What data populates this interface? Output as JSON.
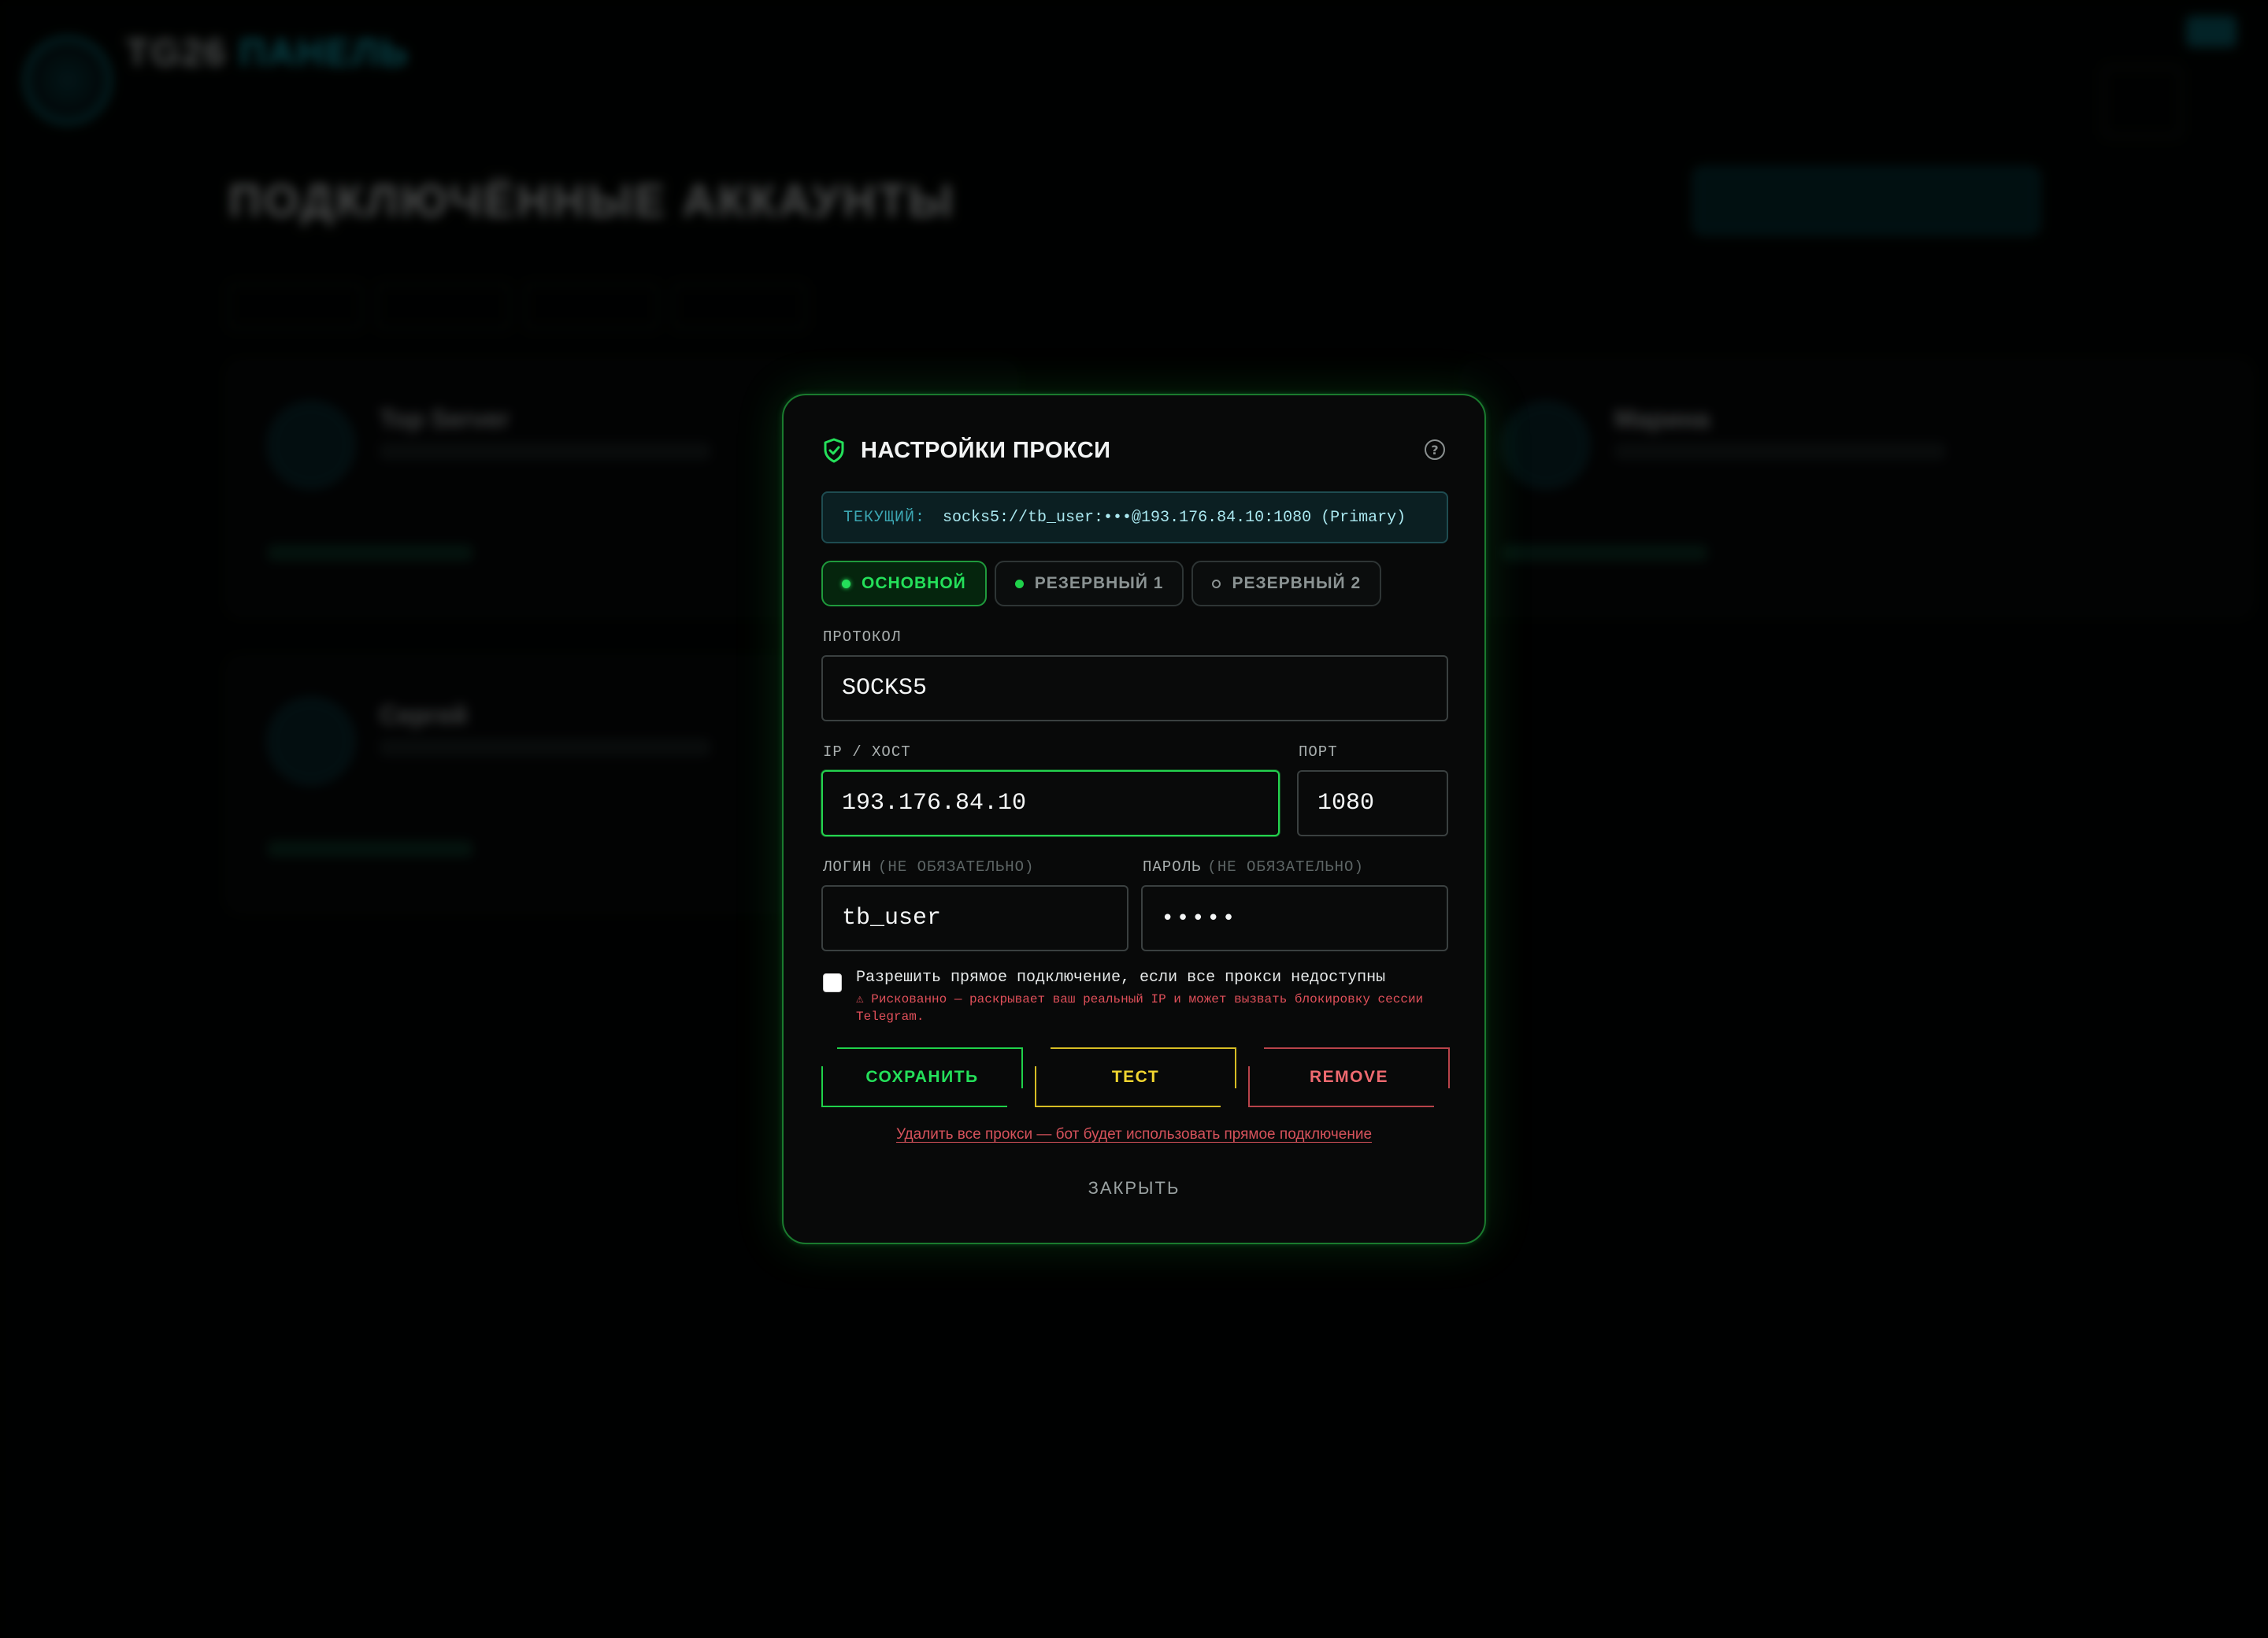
{
  "background": {
    "brand": {
      "title_main": "TG26",
      "title_accent": "ПАНЕЛЬ"
    },
    "page": {
      "title": "ПОДКЛЮЧЁННЫЕ АККАУНТЫ"
    },
    "cards": [
      {
        "name": "Top Server"
      },
      {
        "name": "Марина"
      },
      {
        "name": "Сергей"
      }
    ]
  },
  "modal": {
    "title": "НАСТРОЙКИ ПРОКСИ",
    "current": {
      "label": "ТЕКУЩИЙ:",
      "value": "socks5://tb_user:•••@193.176.84.10:1080 (Primary)"
    },
    "tabs": [
      {
        "label": "ОСНОВНОЙ",
        "active": true,
        "status": "online"
      },
      {
        "label": "РЕЗЕРВНЫЙ 1",
        "active": false,
        "status": "online"
      },
      {
        "label": "РЕЗЕРВНЫЙ 2",
        "active": false,
        "status": "empty"
      }
    ],
    "fields": {
      "protocol": {
        "label": "ПРОТОКОЛ",
        "value": "SOCKS5"
      },
      "host": {
        "label": "IP / ХОСТ",
        "value": "193.176.84.10"
      },
      "port": {
        "label": "ПОРТ",
        "value": "1080"
      },
      "login": {
        "label": "ЛОГИН",
        "optional": "(НЕ ОБЯЗАТЕЛЬНО)",
        "value": "tb_user"
      },
      "password": {
        "label": "ПАРОЛЬ",
        "optional": "(НЕ ОБЯЗАТЕЛЬНО)",
        "value": "•••••"
      }
    },
    "direct_connection": {
      "checked": false,
      "label": "Разрешить прямое подключение, если все прокси недоступны",
      "warning": "⚠ Рискованно — раскрывает ваш реальный IP и может вызвать блокировку сессии Telegram."
    },
    "buttons": {
      "save": "СОХРАНИТЬ",
      "test": "ТЕСТ",
      "remove": "REMOVE"
    },
    "delete_all_link": "Удалить все прокси — бот будет использовать прямое подключение",
    "close_link": "ЗАКРЫТЬ"
  },
  "colors": {
    "accent_green": "#24e05a",
    "accent_cyan": "#19c6d8",
    "warning_yellow": "#f0d530",
    "danger_red": "#ef6a70"
  },
  "icons": {
    "header": "shield-check-icon",
    "help": "help-circle-icon"
  }
}
